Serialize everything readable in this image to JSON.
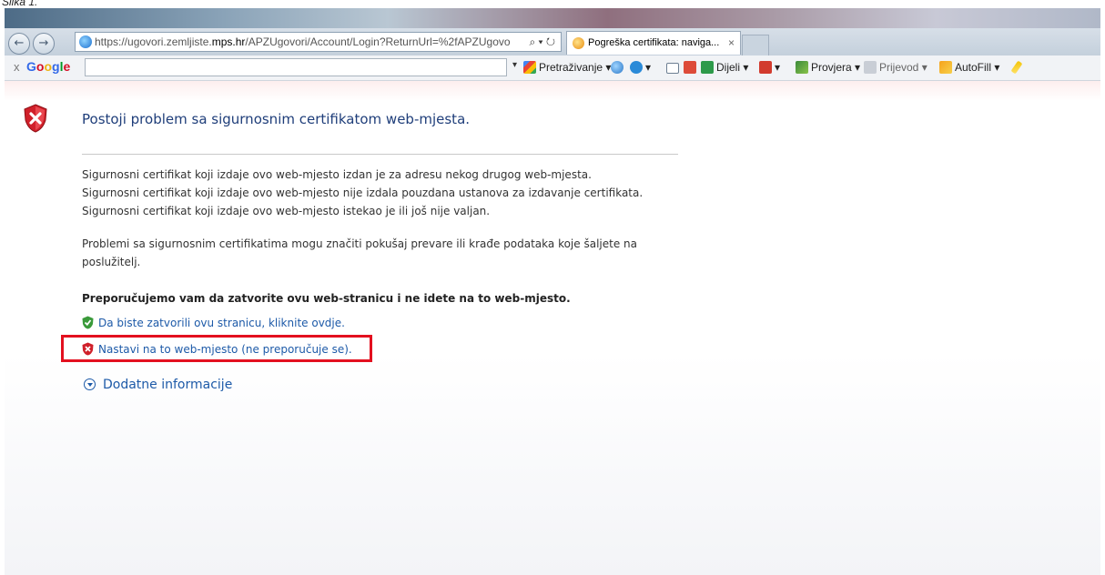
{
  "caption": "Slika 1.",
  "browser": {
    "back_glyph": "←",
    "forward_glyph": "→",
    "url_prefix": "https://ugovori.zemljiste.",
    "url_domain": "mps.hr",
    "url_suffix": "/APZUgovori/Account/Login?ReturnUrl=%2fAPZUgovo",
    "url_tools": "⌕ ▾ ↻",
    "tab_title": "Pogreška certifikata: naviga...",
    "tab_close": "×"
  },
  "toolbar": {
    "close": "x",
    "google_letters": [
      {
        "ch": "G",
        "color": "#3369e8"
      },
      {
        "ch": "o",
        "color": "#d50f25"
      },
      {
        "ch": "o",
        "color": "#eeb211"
      },
      {
        "ch": "g",
        "color": "#3369e8"
      },
      {
        "ch": "l",
        "color": "#009925"
      },
      {
        "ch": "e",
        "color": "#d50f25"
      }
    ],
    "search_dropdown": "▾",
    "search_label": "Pretraživanje ▾",
    "share_label": "Dijeli ▾",
    "check_label": "Provjera ▾",
    "translate_label": "Prijevod ▾",
    "autofill_label": "AutoFill ▾"
  },
  "page": {
    "title": "Postoji problem sa sigurnosnim certifikatom web-mjesta.",
    "reasons": [
      "Sigurnosni certifikat koji izdaje ovo web-mjesto izdan je za adresu nekog drugog web-mjesta.",
      "Sigurnosni certifikat koji izdaje ovo web-mjesto nije izdala pouzdana ustanova za izdavanje certifikata.",
      "Sigurnosni certifikat koji izdaje ovo web-mjesto istekao je ili još nije valjan."
    ],
    "problems_text": "Problemi sa sigurnosnim certifikatima mogu značiti pokušaj prevare ili krađe podataka koje šaljete na poslužitelj.",
    "recommendation": "Preporučujemo vam da zatvorite ovu web-stranicu i ne idete na to web-mjesto.",
    "close_link": "Da biste zatvorili ovu stranicu, kliknite ovdje.",
    "continue_link": "Nastavi na to web-mjesto (ne preporučuje se).",
    "more_info": "Dodatne informacije"
  },
  "colors": {
    "link": "#1d5aa8",
    "title": "#1f3e7a",
    "highlight_box": "#e3101f",
    "shield_red": "#d0202a",
    "shield_green": "#3a9a3a"
  }
}
